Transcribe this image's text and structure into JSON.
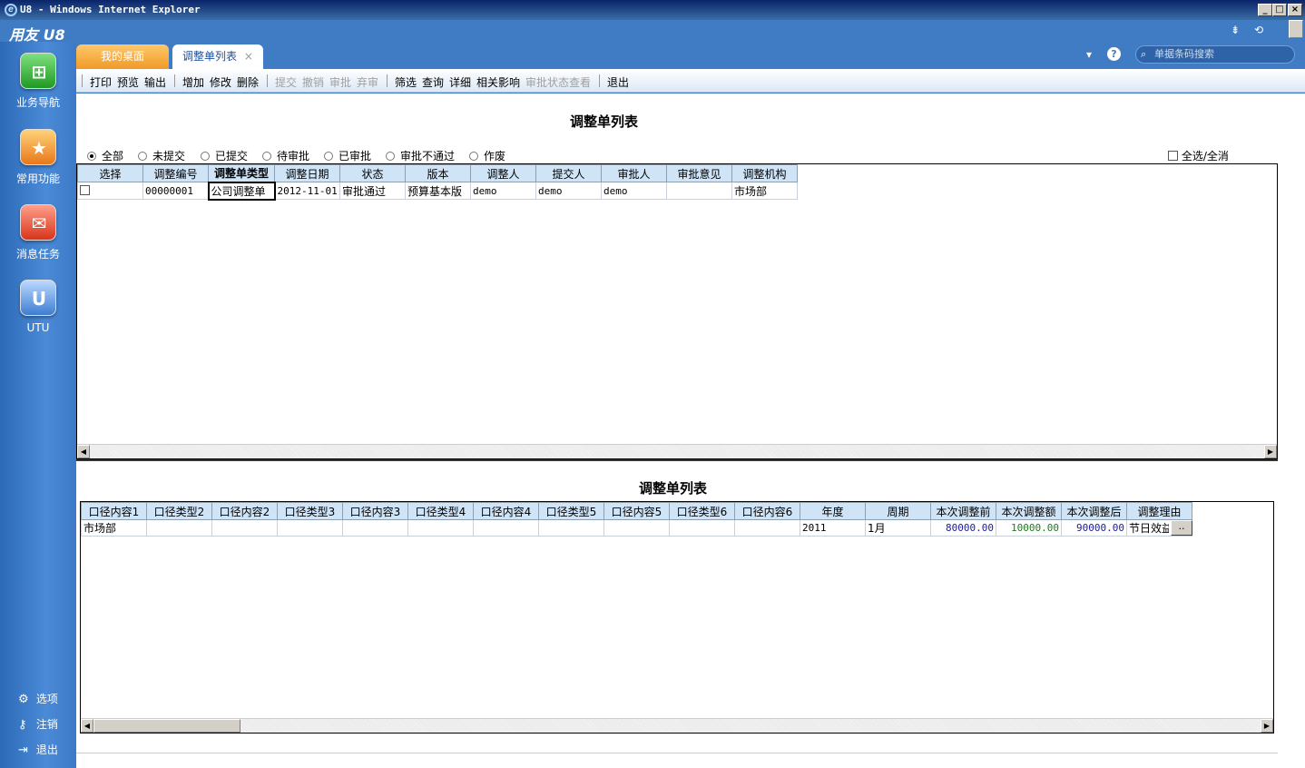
{
  "window": {
    "title": "U8 - Windows Internet Explorer",
    "minimize": "_",
    "maximize": "□",
    "close": "×"
  },
  "app": {
    "logo": "用友 U8",
    "top_icons": [
      "chevron-down-icon",
      "refresh-icon"
    ]
  },
  "sidebar": {
    "items": [
      {
        "label": "业务导航",
        "icon": "navigation-tree-icon"
      },
      {
        "label": "常用功能",
        "icon": "star-icon"
      },
      {
        "label": "消息任务",
        "icon": "mail-icon"
      },
      {
        "label": "UTU",
        "icon": "utu-icon"
      }
    ],
    "bottom": [
      {
        "label": "选项",
        "icon": "gear-icon"
      },
      {
        "label": "注销",
        "icon": "key-icon"
      },
      {
        "label": "退出",
        "icon": "exit-icon"
      }
    ]
  },
  "tabs": [
    {
      "label": "我的桌面",
      "active": false
    },
    {
      "label": "调整单列表",
      "active": true,
      "close": "×"
    }
  ],
  "header_right": {
    "dropdown": "▾",
    "help": "?",
    "search_placeholder": "单据条码搜索"
  },
  "toolbar": {
    "group1": [
      "打印",
      "预览",
      "输出"
    ],
    "group2": [
      "增加",
      "修改",
      "删除"
    ],
    "group3_disabled": [
      "提交",
      "撤销",
      "审批",
      "弃审"
    ],
    "group4": [
      "筛选",
      "查询",
      "详细",
      "相关影响"
    ],
    "group4_disabled": "审批状态查看",
    "group5": [
      "退出"
    ]
  },
  "upper": {
    "title": "调整单列表",
    "filters": [
      {
        "label": "全部",
        "checked": true
      },
      {
        "label": "未提交",
        "checked": false
      },
      {
        "label": "已提交",
        "checked": false
      },
      {
        "label": "待审批",
        "checked": false
      },
      {
        "label": "已审批",
        "checked": false
      },
      {
        "label": "审批不通过",
        "checked": false
      },
      {
        "label": "作废",
        "checked": false
      }
    ],
    "select_all": "全选/全消",
    "columns": [
      "选择",
      "调整编号",
      "调整单类型",
      "调整日期",
      "状态",
      "版本",
      "调整人",
      "提交人",
      "审批人",
      "审批意见",
      "调整机构"
    ],
    "rows": [
      [
        "",
        "00000001",
        "公司调整单",
        "2012-11-01",
        "审批通过",
        "预算基本版",
        "demo",
        "demo",
        "demo",
        "",
        "市场部"
      ]
    ]
  },
  "lower": {
    "title": "调整单列表",
    "columns": [
      "口径内容1",
      "口径类型2",
      "口径内容2",
      "口径类型3",
      "口径内容3",
      "口径类型4",
      "口径内容4",
      "口径类型5",
      "口径内容5",
      "口径类型6",
      "口径内容6",
      "年度",
      "周期",
      "本次调整前",
      "本次调整额",
      "本次调整后",
      "调整理由"
    ],
    "rows": [
      [
        "市场部",
        "",
        "",
        "",
        "",
        "",
        "",
        "",
        "",
        "",
        "",
        "2011",
        "1月",
        "80000.00",
        "10000.00",
        "90000.00",
        "节日效益"
      ]
    ],
    "cell_button": "..",
    "amount_colors": {
      "before": "#1a1a9c",
      "delta": "#1e7a1e",
      "after": "#1a1a9c"
    }
  }
}
